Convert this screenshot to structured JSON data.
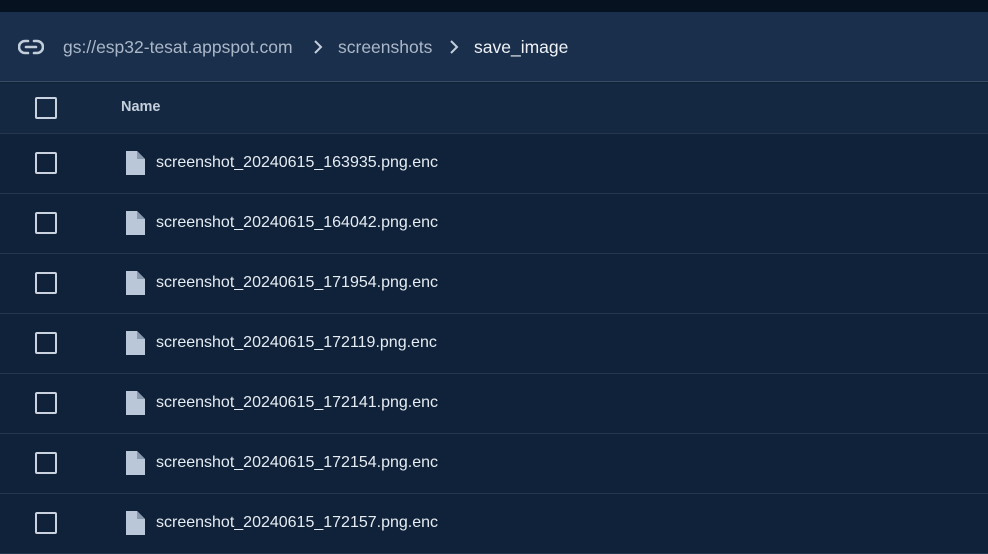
{
  "breadcrumb": {
    "icon": "link-icon",
    "items": [
      {
        "label": "gs://esp32-tesat.appspot.com"
      },
      {
        "label": "screenshots"
      },
      {
        "label": "save_image"
      }
    ]
  },
  "table": {
    "header": {
      "name": "Name"
    },
    "rows": [
      {
        "name": "screenshot_20240615_163935.png.enc",
        "icon": "file-icon"
      },
      {
        "name": "screenshot_20240615_164042.png.enc",
        "icon": "file-icon"
      },
      {
        "name": "screenshot_20240615_171954.png.enc",
        "icon": "file-icon"
      },
      {
        "name": "screenshot_20240615_172119.png.enc",
        "icon": "file-icon"
      },
      {
        "name": "screenshot_20240615_172141.png.enc",
        "icon": "file-icon"
      },
      {
        "name": "screenshot_20240615_172154.png.enc",
        "icon": "file-icon"
      },
      {
        "name": "screenshot_20240615_172157.png.enc",
        "icon": "file-icon"
      }
    ]
  },
  "colors": {
    "background": "#0f2238",
    "breadcrumb_bar": "#1a2f4b",
    "file_icon": "#b9c7d9"
  }
}
